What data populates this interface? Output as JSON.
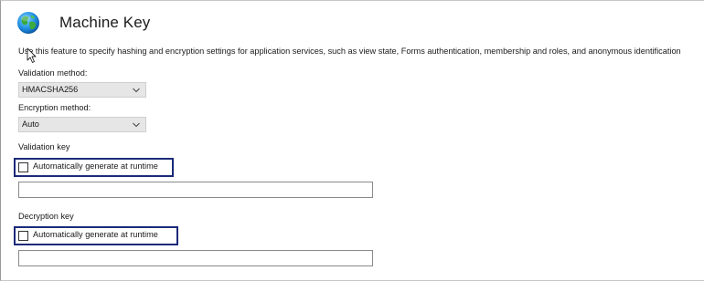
{
  "page": {
    "title": "Machine Key",
    "description": "Use this feature to specify hashing and encryption settings for application services, such as view state, Forms authentication, membership and roles, and anonymous identification"
  },
  "validation_method": {
    "label": "Validation method:",
    "selected": "HMACSHA256"
  },
  "encryption_method": {
    "label": "Encryption method:",
    "selected": "Auto"
  },
  "validation_key": {
    "section_label": "Validation key",
    "checkbox_label": "Automatically generate at runtime",
    "checked": false,
    "value": ""
  },
  "decryption_key": {
    "section_label": "Decryption key",
    "checkbox_label": "Automatically generate at runtime",
    "checked": false,
    "value": ""
  },
  "colors": {
    "highlight_border": "#1b2a78",
    "select_bg": "#e6e6e6"
  },
  "icons": {
    "header": "globe-icon",
    "dropdown": "chevron-down-icon",
    "cursor": "mouse-pointer-icon"
  }
}
